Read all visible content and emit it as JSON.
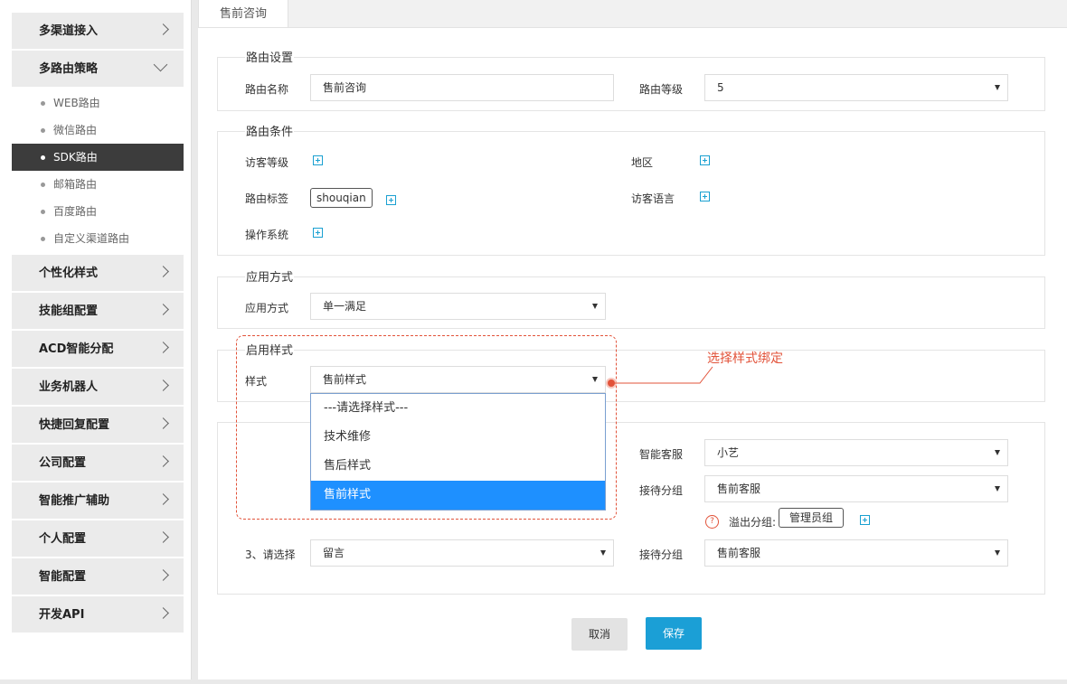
{
  "sidebar": {
    "items": [
      {
        "label": "多渠道接入"
      },
      {
        "label": "多路由策略",
        "expanded": true,
        "children": [
          {
            "label": "WEB路由"
          },
          {
            "label": "微信路由"
          },
          {
            "label": "SDK路由",
            "active": true
          },
          {
            "label": "邮箱路由"
          },
          {
            "label": "百度路由"
          },
          {
            "label": "自定义渠道路由"
          }
        ]
      },
      {
        "label": "个性化样式"
      },
      {
        "label": "技能组配置"
      },
      {
        "label": "ACD智能分配"
      },
      {
        "label": "业务机器人"
      },
      {
        "label": "快捷回复配置"
      },
      {
        "label": "公司配置"
      },
      {
        "label": "智能推广辅助"
      },
      {
        "label": "个人配置"
      },
      {
        "label": "智能配置"
      },
      {
        "label": "开发API"
      }
    ]
  },
  "tab": {
    "label": "售前咨询"
  },
  "route_settings": {
    "title": "路由设置",
    "name_label": "路由名称",
    "name_value": "售前咨询",
    "level_label": "路由等级",
    "level_value": "5"
  },
  "route_conditions": {
    "title": "路由条件",
    "visitor_level_label": "访客等级",
    "region_label": "地区",
    "route_tag_label": "路由标签",
    "route_tag_value": "shouqian",
    "visitor_language_label": "访客语言",
    "os_label": "操作系统"
  },
  "apply_mode": {
    "title": "应用方式",
    "label": "应用方式",
    "value": "单一满足"
  },
  "enable_style": {
    "title": "启用样式",
    "label": "样式",
    "value": "售前样式",
    "options": [
      "---请选择样式---",
      "技术维修",
      "售后样式",
      "售前样式"
    ],
    "selected_index": 3
  },
  "annotation": {
    "text": "选择样式绑定",
    "color": "#e2533a"
  },
  "reception": {
    "smart_service_label": "智能客服",
    "smart_service_value": "小艺",
    "group_label_1": "接待分组",
    "group_value_1": "售前客服",
    "overflow_label": "溢出分组:",
    "overflow_tag": "管理员组",
    "step3_label": "3、请选择",
    "step3_value": "留言",
    "group_label_2": "接待分组",
    "group_value_2": "售前客服"
  },
  "buttons": {
    "cancel": "取消",
    "save": "保存"
  },
  "colors": {
    "accent": "#1b9fd6",
    "selected": "#1e90ff",
    "annotation": "#e2533a",
    "active_menu": "#3c3c3c"
  }
}
